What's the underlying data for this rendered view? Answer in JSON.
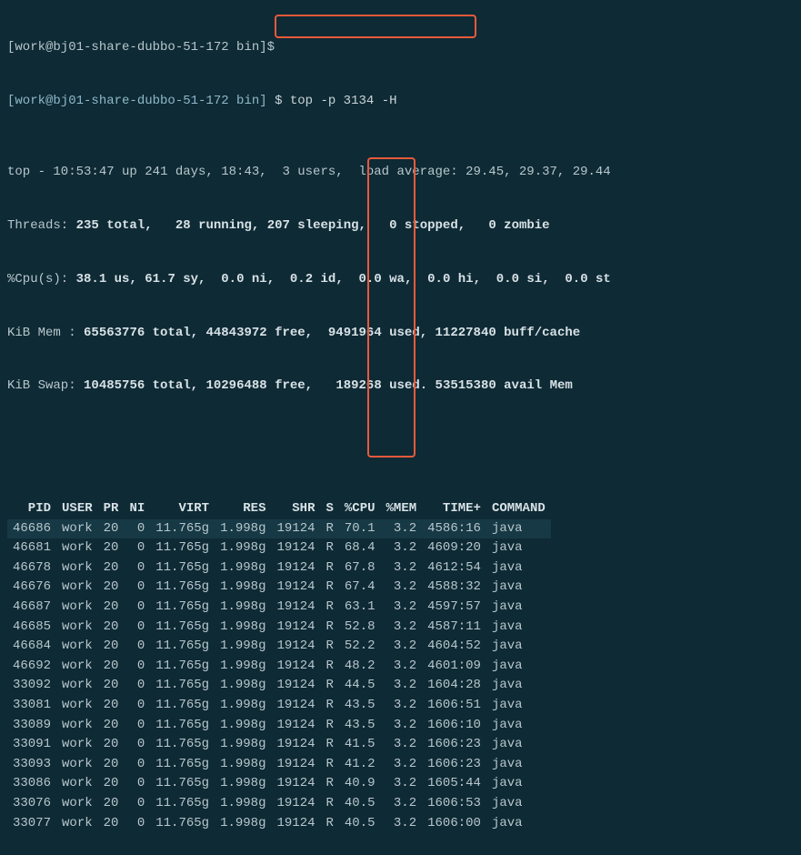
{
  "prompt": {
    "prev_line": "[work@bj01-share-dubbo-51-172 bin]$",
    "user_host": "[work@bj01-share-dubbo-51-172 bin]",
    "dollar": "$",
    "command": "top -p 3134 -H"
  },
  "summary": {
    "line1": "top - 10:53:47 up 241 days, 18:43,  3 users,  load average: 29.45, 29.37, 29.44",
    "threads": {
      "label": "Threads:",
      "total": "235 total,",
      "running": "28 running,",
      "sleeping": "207 sleeping,",
      "stopped": "0 stopped,",
      "zombie": "0 zombie"
    },
    "cpu": {
      "label": "%Cpu(s):",
      "us": "38.1 us,",
      "sy": "61.7 sy,",
      "ni": "0.0 ni,",
      "id": "0.2 id,",
      "wa": "0.0 wa,",
      "hi": "0.0 hi,",
      "si": "0.0 si,",
      "st": "0.0 st"
    },
    "mem": {
      "label": "KiB Mem :",
      "total": "65563776 total,",
      "free": "44843972 free,",
      "used": "9491964 used,",
      "buff": "11227840 buff/cache"
    },
    "swap": {
      "label": "KiB Swap:",
      "total": "10485756 total,",
      "free": "10296488 free,",
      "used": "189268 used.",
      "avail": "53515380 avail Mem"
    }
  },
  "columns": [
    "PID",
    "USER",
    "PR",
    "NI",
    "VIRT",
    "RES",
    "SHR",
    "S",
    "%CPU",
    "%MEM",
    "TIME+",
    "COMMAND"
  ],
  "rows": [
    {
      "pid": "46686",
      "user": "work",
      "pr": "20",
      "ni": "0",
      "virt": "11.765g",
      "res": "1.998g",
      "shr": "19124",
      "s": "R",
      "cpu": "70.1",
      "mem": "3.2",
      "time": "4586:16",
      "cmd": "java",
      "hl": true
    },
    {
      "pid": "46681",
      "user": "work",
      "pr": "20",
      "ni": "0",
      "virt": "11.765g",
      "res": "1.998g",
      "shr": "19124",
      "s": "R",
      "cpu": "68.4",
      "mem": "3.2",
      "time": "4609:20",
      "cmd": "java"
    },
    {
      "pid": "46678",
      "user": "work",
      "pr": "20",
      "ni": "0",
      "virt": "11.765g",
      "res": "1.998g",
      "shr": "19124",
      "s": "R",
      "cpu": "67.8",
      "mem": "3.2",
      "time": "4612:54",
      "cmd": "java"
    },
    {
      "pid": "46676",
      "user": "work",
      "pr": "20",
      "ni": "0",
      "virt": "11.765g",
      "res": "1.998g",
      "shr": "19124",
      "s": "R",
      "cpu": "67.4",
      "mem": "3.2",
      "time": "4588:32",
      "cmd": "java"
    },
    {
      "pid": "46687",
      "user": "work",
      "pr": "20",
      "ni": "0",
      "virt": "11.765g",
      "res": "1.998g",
      "shr": "19124",
      "s": "R",
      "cpu": "63.1",
      "mem": "3.2",
      "time": "4597:57",
      "cmd": "java"
    },
    {
      "pid": "46685",
      "user": "work",
      "pr": "20",
      "ni": "0",
      "virt": "11.765g",
      "res": "1.998g",
      "shr": "19124",
      "s": "R",
      "cpu": "52.8",
      "mem": "3.2",
      "time": "4587:11",
      "cmd": "java"
    },
    {
      "pid": "46684",
      "user": "work",
      "pr": "20",
      "ni": "0",
      "virt": "11.765g",
      "res": "1.998g",
      "shr": "19124",
      "s": "R",
      "cpu": "52.2",
      "mem": "3.2",
      "time": "4604:52",
      "cmd": "java"
    },
    {
      "pid": "46692",
      "user": "work",
      "pr": "20",
      "ni": "0",
      "virt": "11.765g",
      "res": "1.998g",
      "shr": "19124",
      "s": "R",
      "cpu": "48.2",
      "mem": "3.2",
      "time": "4601:09",
      "cmd": "java"
    },
    {
      "pid": "33092",
      "user": "work",
      "pr": "20",
      "ni": "0",
      "virt": "11.765g",
      "res": "1.998g",
      "shr": "19124",
      "s": "R",
      "cpu": "44.5",
      "mem": "3.2",
      "time": "1604:28",
      "cmd": "java"
    },
    {
      "pid": "33081",
      "user": "work",
      "pr": "20",
      "ni": "0",
      "virt": "11.765g",
      "res": "1.998g",
      "shr": "19124",
      "s": "R",
      "cpu": "43.5",
      "mem": "3.2",
      "time": "1606:51",
      "cmd": "java"
    },
    {
      "pid": "33089",
      "user": "work",
      "pr": "20",
      "ni": "0",
      "virt": "11.765g",
      "res": "1.998g",
      "shr": "19124",
      "s": "R",
      "cpu": "43.5",
      "mem": "3.2",
      "time": "1606:10",
      "cmd": "java"
    },
    {
      "pid": "33091",
      "user": "work",
      "pr": "20",
      "ni": "0",
      "virt": "11.765g",
      "res": "1.998g",
      "shr": "19124",
      "s": "R",
      "cpu": "41.5",
      "mem": "3.2",
      "time": "1606:23",
      "cmd": "java"
    },
    {
      "pid": "33093",
      "user": "work",
      "pr": "20",
      "ni": "0",
      "virt": "11.765g",
      "res": "1.998g",
      "shr": "19124",
      "s": "R",
      "cpu": "41.2",
      "mem": "3.2",
      "time": "1606:23",
      "cmd": "java"
    },
    {
      "pid": "33086",
      "user": "work",
      "pr": "20",
      "ni": "0",
      "virt": "11.765g",
      "res": "1.998g",
      "shr": "19124",
      "s": "R",
      "cpu": "40.9",
      "mem": "3.2",
      "time": "1605:44",
      "cmd": "java"
    },
    {
      "pid": "33076",
      "user": "work",
      "pr": "20",
      "ni": "0",
      "virt": "11.765g",
      "res": "1.998g",
      "shr": "19124",
      "s": "R",
      "cpu": "40.5",
      "mem": "3.2",
      "time": "1606:53",
      "cmd": "java"
    },
    {
      "pid": "33077",
      "user": "work",
      "pr": "20",
      "ni": "0",
      "virt": "11.765g",
      "res": "1.998g",
      "shr": "19124",
      "s": "R",
      "cpu": "40.5",
      "mem": "3.2",
      "time": "1606:00",
      "cmd": "java"
    }
  ]
}
